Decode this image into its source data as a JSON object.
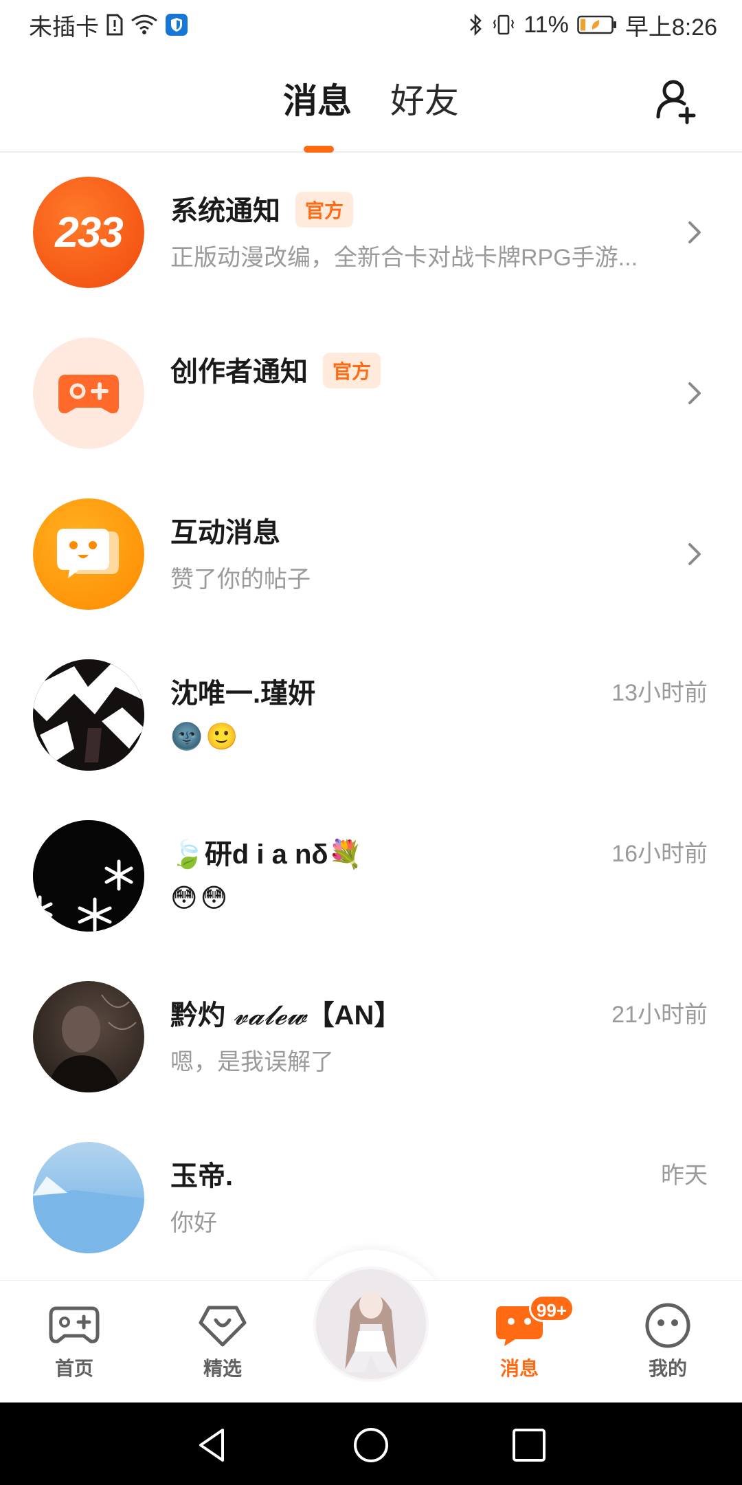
{
  "status_bar": {
    "carrier": "未插卡",
    "battery_percent": "11%",
    "time": "早上8:26",
    "icons": [
      "sim-alert-icon",
      "wifi-icon",
      "shield-app-icon",
      "bluetooth-icon",
      "vibrate-icon",
      "battery-icon"
    ]
  },
  "header": {
    "tabs": [
      {
        "label": "消息",
        "active": true
      },
      {
        "label": "好友",
        "active": false
      }
    ],
    "add_friend_icon": "add-friend-icon"
  },
  "conversations": [
    {
      "name": "系统通知",
      "badge": "官方",
      "preview": "正版动漫改编，全新合卡对战卡牌RPG手游...",
      "avatar_text": "233",
      "trailing": "chevron"
    },
    {
      "name": "创作者通知",
      "badge": "官方",
      "preview": "",
      "avatar_icon": "gamepad-icon",
      "trailing": "chevron"
    },
    {
      "name": "互动消息",
      "preview": "赞了你的帖子",
      "avatar_icon": "chat-bubble-icon",
      "trailing": "chevron"
    },
    {
      "name": "沈唯一.瑾妍",
      "time": "13小时前",
      "preview_emojis": [
        "🌚",
        "🙂"
      ]
    },
    {
      "name": "研d i a nδ",
      "name_emoji_left": "🍃",
      "name_emoji_right": "💐",
      "time": "16小时前",
      "preview_emojis": [
        "😳",
        "😳"
      ]
    },
    {
      "name": "黔灼",
      "name_script": "𝓿𝓪𝓵𝓮𝔀",
      "name_suffix": "【AN】",
      "time": "21小时前",
      "preview": "嗯，是我误解了"
    },
    {
      "name": "玉帝.",
      "time": "昨天",
      "preview": "你好"
    }
  ],
  "bottom_nav": {
    "items": [
      {
        "label": "首页",
        "icon": "gamepad-icon"
      },
      {
        "label": "精选",
        "icon": "heart-badge-icon"
      },
      {
        "label": "消息",
        "icon": "chat-bubble-icon",
        "badge": "99+",
        "active": true
      },
      {
        "label": "我的",
        "icon": "face-icon"
      }
    ]
  },
  "colors": {
    "accent": "#ff6a13",
    "badge_bg": "#ffeadc",
    "text_primary": "#1a1a1a",
    "text_secondary": "#9a9a9a"
  }
}
